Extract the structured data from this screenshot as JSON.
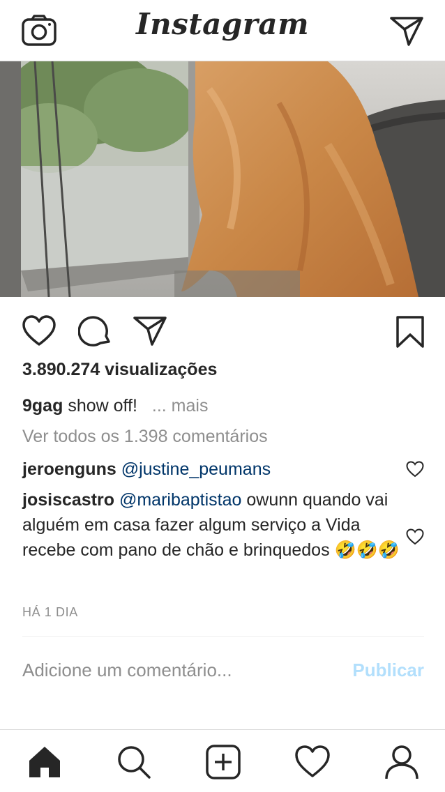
{
  "header": {
    "logo": "Instagram",
    "camera_icon": "camera-icon",
    "direct_icon": "direct-message-icon"
  },
  "post": {
    "media_description": "video",
    "views": "3.890.274 visualizações",
    "caption": {
      "user": "9gag",
      "text": "show off!",
      "more": "... mais"
    },
    "view_all_comments": "Ver todos os 1.398 comentários",
    "comments": [
      {
        "user": "jeroenguns",
        "mention": "@justine_peumans",
        "text": ""
      },
      {
        "user": "josiscastro",
        "mention": "@maribaptistao",
        "text": "owunn quando vai alguém em casa fazer algum serviço a Vida recebe com pano de chão e brinquedos 🤣🤣🤣"
      }
    ],
    "time": "HÁ 1 DIA",
    "add_comment_placeholder": "Adicione um comentário...",
    "publish_label": "Publicar"
  },
  "colors": {
    "text": "#262626",
    "muted": "#8e8e8e",
    "mention": "#003569",
    "publish_disabled": "#b2dffc",
    "border": "#dbdbdb"
  },
  "nav": {
    "icons": [
      "home-icon",
      "search-icon",
      "add-post-icon",
      "activity-heart-icon",
      "profile-icon"
    ]
  }
}
